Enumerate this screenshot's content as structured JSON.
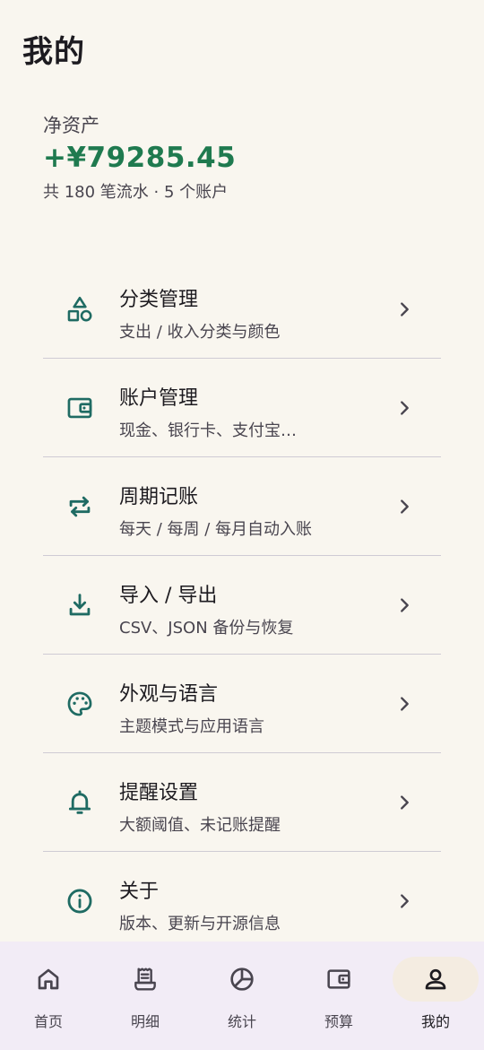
{
  "page": {
    "title": "我的"
  },
  "summary": {
    "label": "净资产",
    "amount": "+¥79285.45",
    "meta": "共 180 笔流水 · 5 个账户"
  },
  "menu": [
    {
      "title": "分类管理",
      "subtitle": "支出 / 收入分类与颜色",
      "icon": "category-icon"
    },
    {
      "title": "账户管理",
      "subtitle": "现金、银行卡、支付宝…",
      "icon": "wallet-icon"
    },
    {
      "title": "周期记账",
      "subtitle": "每天 / 每周 / 每月自动入账",
      "icon": "repeat-icon"
    },
    {
      "title": "导入 / 导出",
      "subtitle": "CSV、JSON 备份与恢复",
      "icon": "download-icon"
    },
    {
      "title": "外观与语言",
      "subtitle": "主题模式与应用语言",
      "icon": "palette-icon"
    },
    {
      "title": "提醒设置",
      "subtitle": "大额阈值、未记账提醒",
      "icon": "bell-icon"
    },
    {
      "title": "关于",
      "subtitle": "版本、更新与开源信息",
      "icon": "info-icon"
    }
  ],
  "nav": [
    {
      "label": "首页",
      "icon": "home-icon",
      "active": false
    },
    {
      "label": "明细",
      "icon": "receipt-icon",
      "active": false
    },
    {
      "label": "统计",
      "icon": "pie-chart-icon",
      "active": false
    },
    {
      "label": "预算",
      "icon": "wallet-icon",
      "active": false
    },
    {
      "label": "我的",
      "icon": "person-icon",
      "active": true
    }
  ],
  "colors": {
    "accent": "#1f6b63",
    "positive": "#1f7a4f",
    "background": "#f9f6ef",
    "nav_background": "#f2ecf6",
    "nav_active_pill": "#f4ece1"
  }
}
